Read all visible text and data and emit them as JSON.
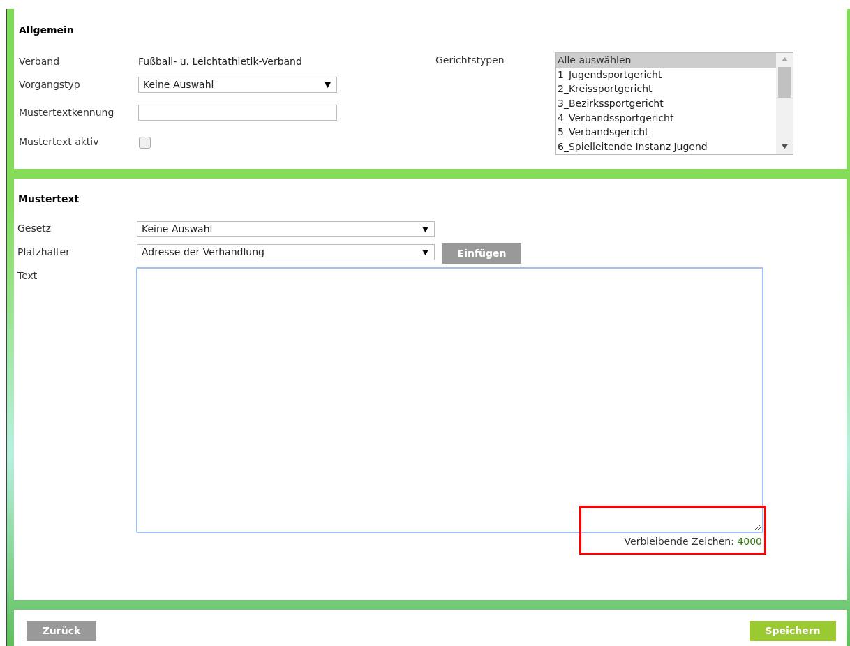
{
  "general": {
    "title": "Allgemein",
    "verband": {
      "label": "Verband",
      "value": "Fußball- u. Leichtathletik-Verband"
    },
    "vorgangstyp": {
      "label": "Vorgangstyp",
      "value": "Keine Auswahl"
    },
    "kennung": {
      "label": "Mustertextkennung"
    },
    "aktiv": {
      "label": "Mustertext aktiv",
      "checked": false
    },
    "gerichtstypen": {
      "label": "Gerichtstypen",
      "items": [
        {
          "label": "Alle auswählen",
          "selected": true
        },
        {
          "label": "1_Jugendsportgericht",
          "selected": false
        },
        {
          "label": "2_Kreissportgericht",
          "selected": false
        },
        {
          "label": "3_Bezirkssportgericht",
          "selected": false
        },
        {
          "label": "4_Verbandssportgericht",
          "selected": false
        },
        {
          "label": "5_Verbandsgericht",
          "selected": false
        },
        {
          "label": "6_Spielleitende Instanz Jugend",
          "selected": false
        }
      ]
    }
  },
  "mustertext": {
    "title": "Mustertext",
    "gesetz": {
      "label": "Gesetz",
      "value": "Keine Auswahl"
    },
    "platzhalter": {
      "label": "Platzhalter",
      "value": "Adresse der Verhandlung",
      "button": "Einfügen"
    },
    "text": {
      "label": "Text"
    },
    "counter": {
      "label": "Verbleibende Zeichen:",
      "value": "4000",
      "highlighted": true
    }
  },
  "footer": {
    "back": "Zurück",
    "save": "Speichern"
  }
}
